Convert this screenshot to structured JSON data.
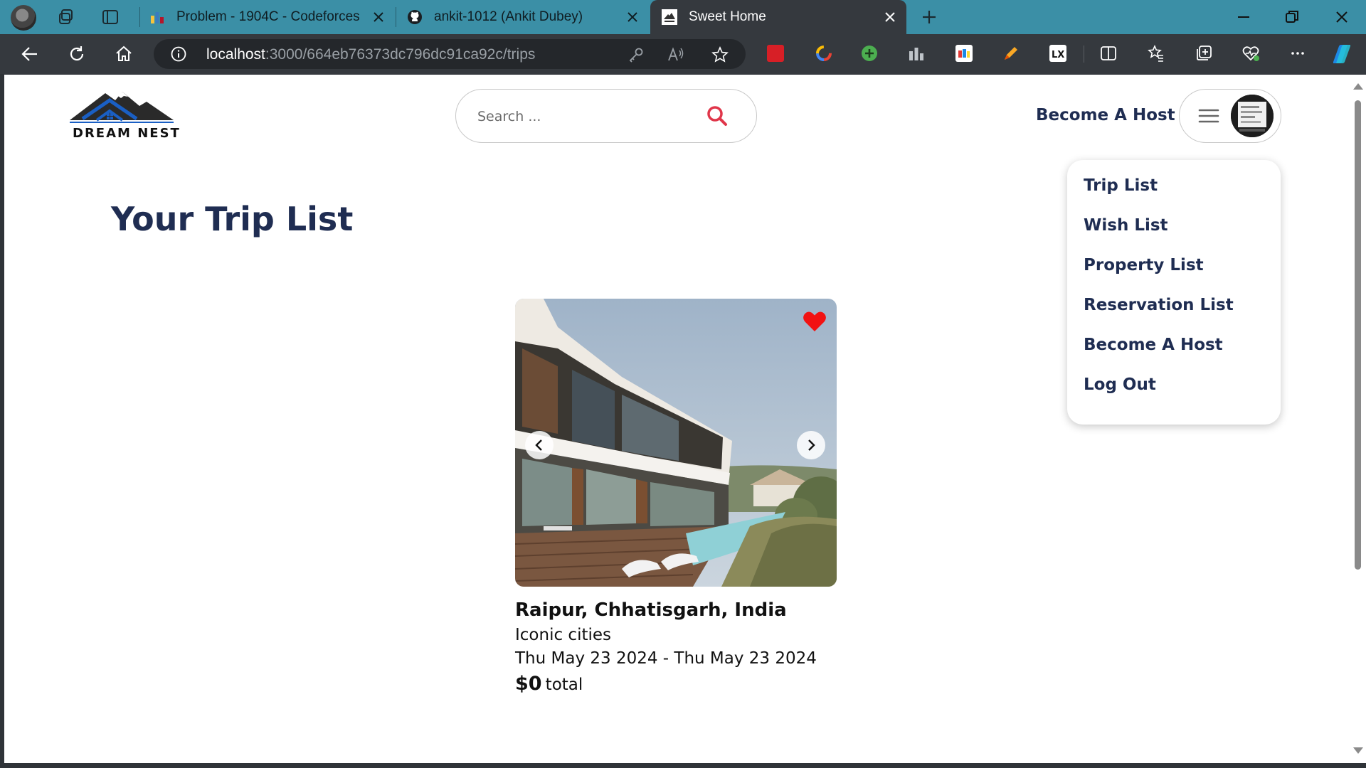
{
  "tabs": [
    {
      "title": "Problem - 1904C - Codeforces",
      "icon": "codeforces-icon"
    },
    {
      "title": "ankit-1012 (Ankit Dubey)",
      "icon": "github-icon"
    },
    {
      "title": "Sweet Home",
      "icon": "dream-nest-favicon",
      "active": true
    }
  ],
  "address_bar": {
    "host": "localhost",
    "path": ":3000/664eb76373dc796dc91ca92c/trips"
  },
  "site": {
    "brand": "DREAM NEST",
    "search_placeholder": "Search ...",
    "become_host": "Become A Host",
    "accent_color": "#1f2d52",
    "search_icon_color": "#e0364a"
  },
  "menu": {
    "items": [
      "Trip List",
      "Wish List",
      "Property List",
      "Reservation List",
      "Become A Host",
      "Log Out"
    ]
  },
  "page": {
    "title": "Your Trip List"
  },
  "trips": [
    {
      "location": "Raipur, Chhatisgarh, India",
      "category": "Iconic cities",
      "dates": "Thu May 23 2024 - Thu May 23 2024",
      "price": "$0",
      "price_label": "total",
      "liked": true
    }
  ]
}
